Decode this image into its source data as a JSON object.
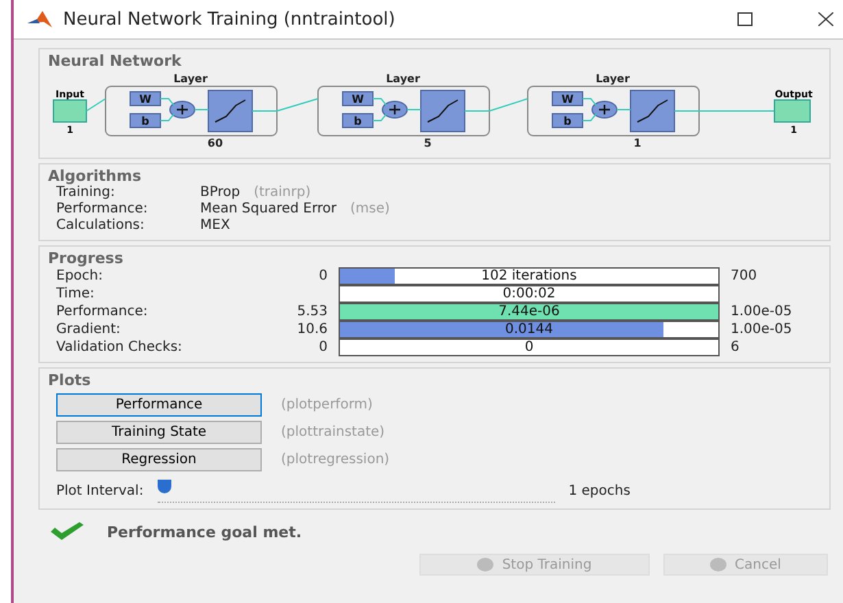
{
  "window": {
    "title": "Neural Network Training (nntraintool)"
  },
  "network": {
    "title": "Neural Network",
    "input": {
      "label": "Input",
      "size": "1"
    },
    "output": {
      "label": "Output",
      "size": "1"
    },
    "layers": [
      {
        "label": "Layer",
        "w": "W",
        "b": "b",
        "size": "60"
      },
      {
        "label": "Layer",
        "w": "W",
        "b": "b",
        "size": "5"
      },
      {
        "label": "Layer",
        "w": "W",
        "b": "b",
        "size": "1"
      }
    ]
  },
  "algorithms": {
    "title": "Algorithms",
    "rows": [
      {
        "label": "Training:",
        "value": "BProp",
        "fn": "(trainrp)"
      },
      {
        "label": "Performance:",
        "value": "Mean Squared Error",
        "fn": "(mse)"
      },
      {
        "label": "Calculations:",
        "value": "MEX"
      }
    ]
  },
  "progress": {
    "title": "Progress",
    "rows": [
      {
        "label": "Epoch:",
        "start": "0",
        "reading": "102 iterations",
        "level": 0.146,
        "color": "#6f8fe0",
        "end": "700"
      },
      {
        "label": "Time:",
        "reading": "0:00:02"
      },
      {
        "label": "Performance:",
        "start": "5.53",
        "reading": "7.44e-06",
        "level": 1,
        "color": "#6fe0b0",
        "end": "1.00e-05"
      },
      {
        "label": "Gradient:",
        "start": "10.6",
        "reading": "0.0144",
        "level": 0.855,
        "color": "#6f8fe0",
        "end": "1.00e-05"
      },
      {
        "label": "Validation Checks:",
        "start": "0",
        "reading": "0",
        "end": "6"
      }
    ]
  },
  "plots": {
    "title": "Plots",
    "buttons": [
      {
        "label": "Performance",
        "fn": "(plotperform)",
        "focused": true
      },
      {
        "label": "Training State",
        "fn": "(plottrainstate)",
        "focused": false
      },
      {
        "label": "Regression",
        "fn": "(plotregression)",
        "focused": false
      }
    ],
    "interval": {
      "label": "Plot Interval:",
      "level": 0,
      "reading": "1 epochs"
    }
  },
  "status": {
    "text": "Performance goal met."
  },
  "buttons": [
    {
      "label": "Stop Training",
      "kind": "stop",
      "disabled": true
    },
    {
      "label": "Cancel",
      "kind": "cancel",
      "disabled": true
    }
  ]
}
